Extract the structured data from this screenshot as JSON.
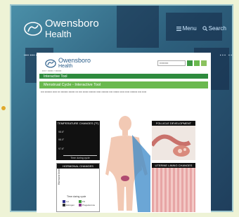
{
  "site": {
    "logo_line1": "Owensboro",
    "logo_line2": "Health",
    "menu_label": "Menu",
    "search_label": "Search"
  },
  "inner_page": {
    "logo_line1": "Owensboro",
    "logo_line2": "Health",
    "section_bar": "Interactive Tool",
    "tool_title": "Menstrual Cycle - Interactive Tool",
    "panels": {
      "temperature": "TEMPERATURE CHANGES (°F)",
      "temp_ticks": [
        "98.6°",
        "98.0°",
        "97.6°"
      ],
      "temp_caption": "Time during cycle",
      "follicle": "FOLLICLE DEVELOPMENT",
      "hormonal": "HORMONAL CHANGES",
      "hormonal_ylabel": "Hormone levels",
      "hormonal_xlabel": "Time during cycle",
      "uterine": "UTERINE LINING CHANGES"
    },
    "legend": [
      {
        "label": "LH",
        "color": "#2b2b8a"
      },
      {
        "label": "FS",
        "color": "#3b9a3b"
      },
      {
        "label": "Estrogen",
        "color": "#333333"
      },
      {
        "label": "Progesterone",
        "color": "#8a3b8a"
      }
    ]
  }
}
